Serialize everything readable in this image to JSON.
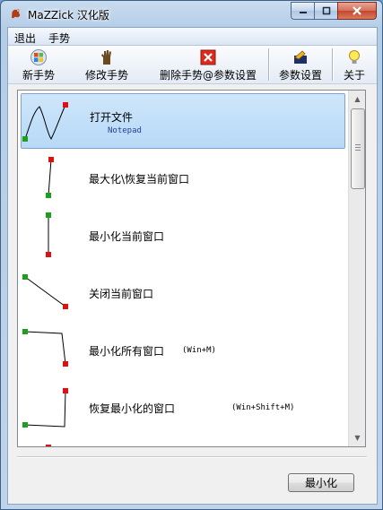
{
  "window": {
    "title": "MaZZick 汉化版"
  },
  "menu": {
    "items": [
      "退出",
      "手势"
    ]
  },
  "toolbar": {
    "new_label": "新手势",
    "edit_label": "修改手势",
    "delete_label": "删除手势@参数设置",
    "settings_label": "参数设置",
    "about_label": "关于"
  },
  "gestures": [
    {
      "label": "打开文件",
      "sub": "Notepad",
      "hotkey": ""
    },
    {
      "label": "最大化\\恢复当前窗口",
      "sub": "",
      "hotkey": ""
    },
    {
      "label": "最小化当前窗口",
      "sub": "",
      "hotkey": ""
    },
    {
      "label": "关闭当前窗口",
      "sub": "",
      "hotkey": ""
    },
    {
      "label": "最小化所有窗口",
      "sub": "",
      "hotkey": "(Win+M)"
    },
    {
      "label": "恢复最小化的窗口",
      "sub": "",
      "hotkey": "(Win+Shift+M)"
    }
  ],
  "footer": {
    "minimize_label": "最小化"
  },
  "colors": {
    "start_marker": "#1aa01a",
    "end_marker": "#e01010",
    "selection": "#b7d9f7"
  },
  "icons": {
    "app": "dragon-icon",
    "new": "windows-flag-icon",
    "edit": "hand-icon",
    "delete": "red-x-icon",
    "settings": "tools-icon",
    "about": "lightbulb-icon"
  }
}
